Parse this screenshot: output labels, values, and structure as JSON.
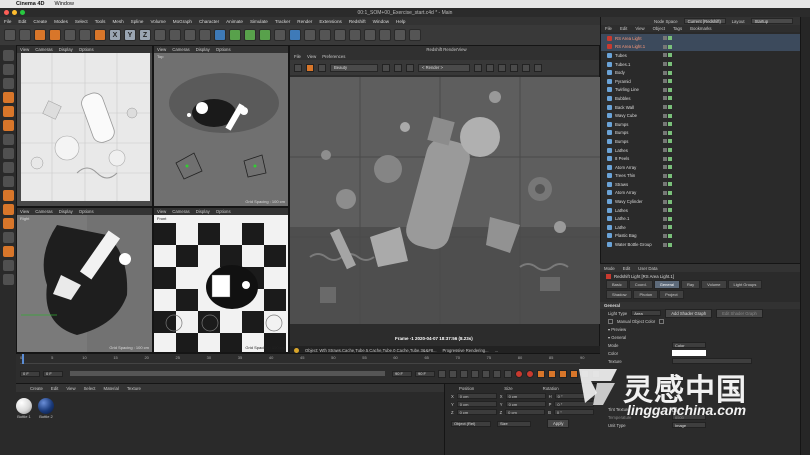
{
  "macbar": {
    "apple": "",
    "app": "Cinema 4D",
    "menu": "Window"
  },
  "title": "00:1_SOM+00_Exercise_start.c4d * - Main",
  "menubar": [
    "File",
    "Edit",
    "Create",
    "Modes",
    "Select",
    "Tools",
    "Mesh",
    "Spline",
    "Volume",
    "MoGraph",
    "Character",
    "Animate",
    "Simulate",
    "Tracker",
    "Render",
    "Extensions",
    "Redshift",
    "Window",
    "Help"
  ],
  "toolbar": {
    "x": "X",
    "y": "Y",
    "z": "Z"
  },
  "viewports": {
    "menu": [
      "View",
      "Cameras",
      "Display",
      "Options"
    ],
    "top_left": {
      "label": "",
      "foot": ""
    },
    "top_right": {
      "label": "Top",
      "foot": "Grid Spacing : 100 cm"
    },
    "bottom_left": {
      "label": "Right",
      "foot": "Grid Spacing : 100 cm"
    },
    "bottom_right": {
      "label": "Front",
      "foot": "Grid Spacing : 100 cm"
    }
  },
  "render_view": {
    "title": "Redshift RenderView",
    "menu": [
      "File",
      "View",
      "Preferences"
    ],
    "aov_select": "Beauty",
    "camera_select": "< Render >",
    "frame_info": "Frame -1  2020-04-07  18:37:56  (8.23s)",
    "status": "Object: Wth Straws.Cache,Tube.5.Cache,Tube.0.Cache,Tube.3&&#8...",
    "progress": "Progressive Rendering...",
    "progress_value": "..."
  },
  "object_manager": {
    "node_space_label": "Node Space",
    "node_space_value": "Current (Redshift)",
    "layout_label": "Layout",
    "layout_value": "Startup",
    "menu": [
      "File",
      "Edit",
      "View",
      "Object",
      "Tags",
      "Bookmarks"
    ],
    "objects": [
      {
        "name": "RS Area Light",
        "active": true
      },
      {
        "name": "RS Area Light.1",
        "active": true
      },
      {
        "name": "Tubes",
        "active": false
      },
      {
        "name": "Tubes.1",
        "active": false
      },
      {
        "name": "Body",
        "active": false
      },
      {
        "name": "Pyramid",
        "active": false
      },
      {
        "name": "Twirling Line",
        "active": false
      },
      {
        "name": "Bubbles",
        "active": false
      },
      {
        "name": "Back Wall",
        "active": false
      },
      {
        "name": "Wavy Cube",
        "active": false
      },
      {
        "name": "Bumps",
        "active": false
      },
      {
        "name": "Bumps",
        "active": false
      },
      {
        "name": "Bumps",
        "active": false
      },
      {
        "name": "Lathes",
        "active": false
      },
      {
        "name": "8 Peels",
        "active": false
      },
      {
        "name": "Atom Array",
        "active": false
      },
      {
        "name": "Trees Thin",
        "active": false
      },
      {
        "name": "Straws",
        "active": false
      },
      {
        "name": "Atom Array",
        "active": false
      },
      {
        "name": "Wavy Cylinder",
        "active": false
      },
      {
        "name": "Lathes",
        "active": false
      },
      {
        "name": "Lathe.1",
        "active": false
      },
      {
        "name": "Lathe",
        "active": false
      },
      {
        "name": "Plastic Bag",
        "active": false
      },
      {
        "name": "Water Bottle Group",
        "active": false
      }
    ]
  },
  "attribute_manager": {
    "menu": [
      "Mode",
      "Edit",
      "User Data"
    ],
    "title": "Redshift Light [RS Area Light.1]",
    "tabs_row1": [
      "Basic",
      "Coord.",
      "General",
      "Ray",
      "Volume",
      "Light Groups"
    ],
    "tabs_row2": [
      "Shadow",
      "Photon",
      "Project"
    ],
    "active_tab": "General",
    "section": "General",
    "light_type_label": "Light Type",
    "light_type_value": "Area",
    "add_shader_graph": "Add Shader Graph",
    "edit_shader_graph": "Edit Shader Graph",
    "manual_object_color": "Manual Object Color",
    "preview": "▾ Preview",
    "general_sub": "▾ General",
    "mode_label": "Mode",
    "mode_value": "Color",
    "color_label": "Color",
    "texture_label": "Texture",
    "tint_texture": "Tint Texture",
    "temperature_label": "Temperature",
    "temperature_value": "6500",
    "unit_type_label": "Unit Type",
    "unit_type_value": "Image"
  },
  "timeline": {
    "ticks": [
      "0",
      "5",
      "10",
      "15",
      "20",
      "25",
      "30",
      "35",
      "40",
      "45",
      "50",
      "55",
      "60",
      "65",
      "70",
      "75",
      "80",
      "85",
      "90"
    ],
    "start": "0 F",
    "current": "0 F",
    "end1": "90 F",
    "end2": "90 F",
    "frame_display": "0 F"
  },
  "material_manager": {
    "menu": [
      "Create",
      "Edit",
      "View",
      "Select",
      "Material",
      "Texture"
    ],
    "materials": [
      {
        "name": "Bottle 1",
        "color": "#d9d9d9"
      },
      {
        "name": "Bottle 2",
        "color": "#1a3a7a"
      }
    ]
  },
  "coordinates": {
    "headers": [
      "Position",
      "Size",
      "Rotation"
    ],
    "rows": [
      {
        "axis": "X",
        "pos": "0 cm",
        "size_axis": "X",
        "size": "0 cm",
        "rot_axis": "H",
        "rot": "0 °"
      },
      {
        "axis": "Y",
        "pos": "0 cm",
        "size_axis": "Y",
        "size": "0 cm",
        "rot_axis": "P",
        "rot": "0 °"
      },
      {
        "axis": "Z",
        "pos": "0 cm",
        "size_axis": "Z",
        "size": "0 cm",
        "rot_axis": "B",
        "rot": "0 °"
      }
    ],
    "mode": "Object (Rel)",
    "size_mode": "Size",
    "apply": "Apply"
  },
  "watermark": {
    "cn": "灵感中国",
    "en": "lingganchina.com"
  },
  "colors": {
    "accent_orange": "#d8762a",
    "accent_blue": "#3e7ab8",
    "selected_text": "#ff9a7a"
  }
}
